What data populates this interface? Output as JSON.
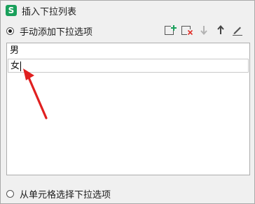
{
  "window": {
    "title": "插入下拉列表",
    "app_icon_letter": "S"
  },
  "options": {
    "manual_label": "手动添加下拉选项",
    "manual_selected": true,
    "cell_label": "从单元格选择下拉选项",
    "cell_selected": false
  },
  "toolbar": {
    "icons": [
      "add-item-icon",
      "delete-item-icon",
      "move-down-icon",
      "move-up-icon",
      "edit-icon"
    ],
    "enabled": [
      true,
      true,
      false,
      true,
      true
    ]
  },
  "list": {
    "items": [
      "男",
      "女"
    ],
    "editing_index": 1
  },
  "colors": {
    "accent_green": "#19a05b",
    "delete_red": "#e0302a",
    "annotation_arrow": "#e02020"
  }
}
